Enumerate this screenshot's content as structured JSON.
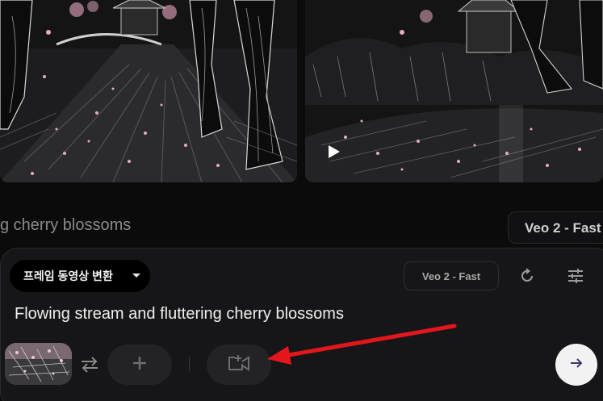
{
  "history": {
    "prompt_fragment": "g cherry blossoms",
    "model_label": "Veo 2 - Fast"
  },
  "composer": {
    "mode_label": "프레임 동영상 변환",
    "model_label": "Veo 2 - Fast",
    "prompt_text": "Flowing stream and fluttering cherry blossoms"
  },
  "icons": {
    "play": "play-icon",
    "refresh": "refresh-icon",
    "settings": "sliders-icon",
    "swap": "swap-arrows-icon",
    "add": "plus-icon",
    "camera": "camera-add-icon",
    "send": "arrow-right-icon"
  },
  "colors": {
    "background": "#0b0b0c",
    "panel": "#161618",
    "annotation_arrow": "#e3161b",
    "blossom": "#e8a9c4"
  }
}
